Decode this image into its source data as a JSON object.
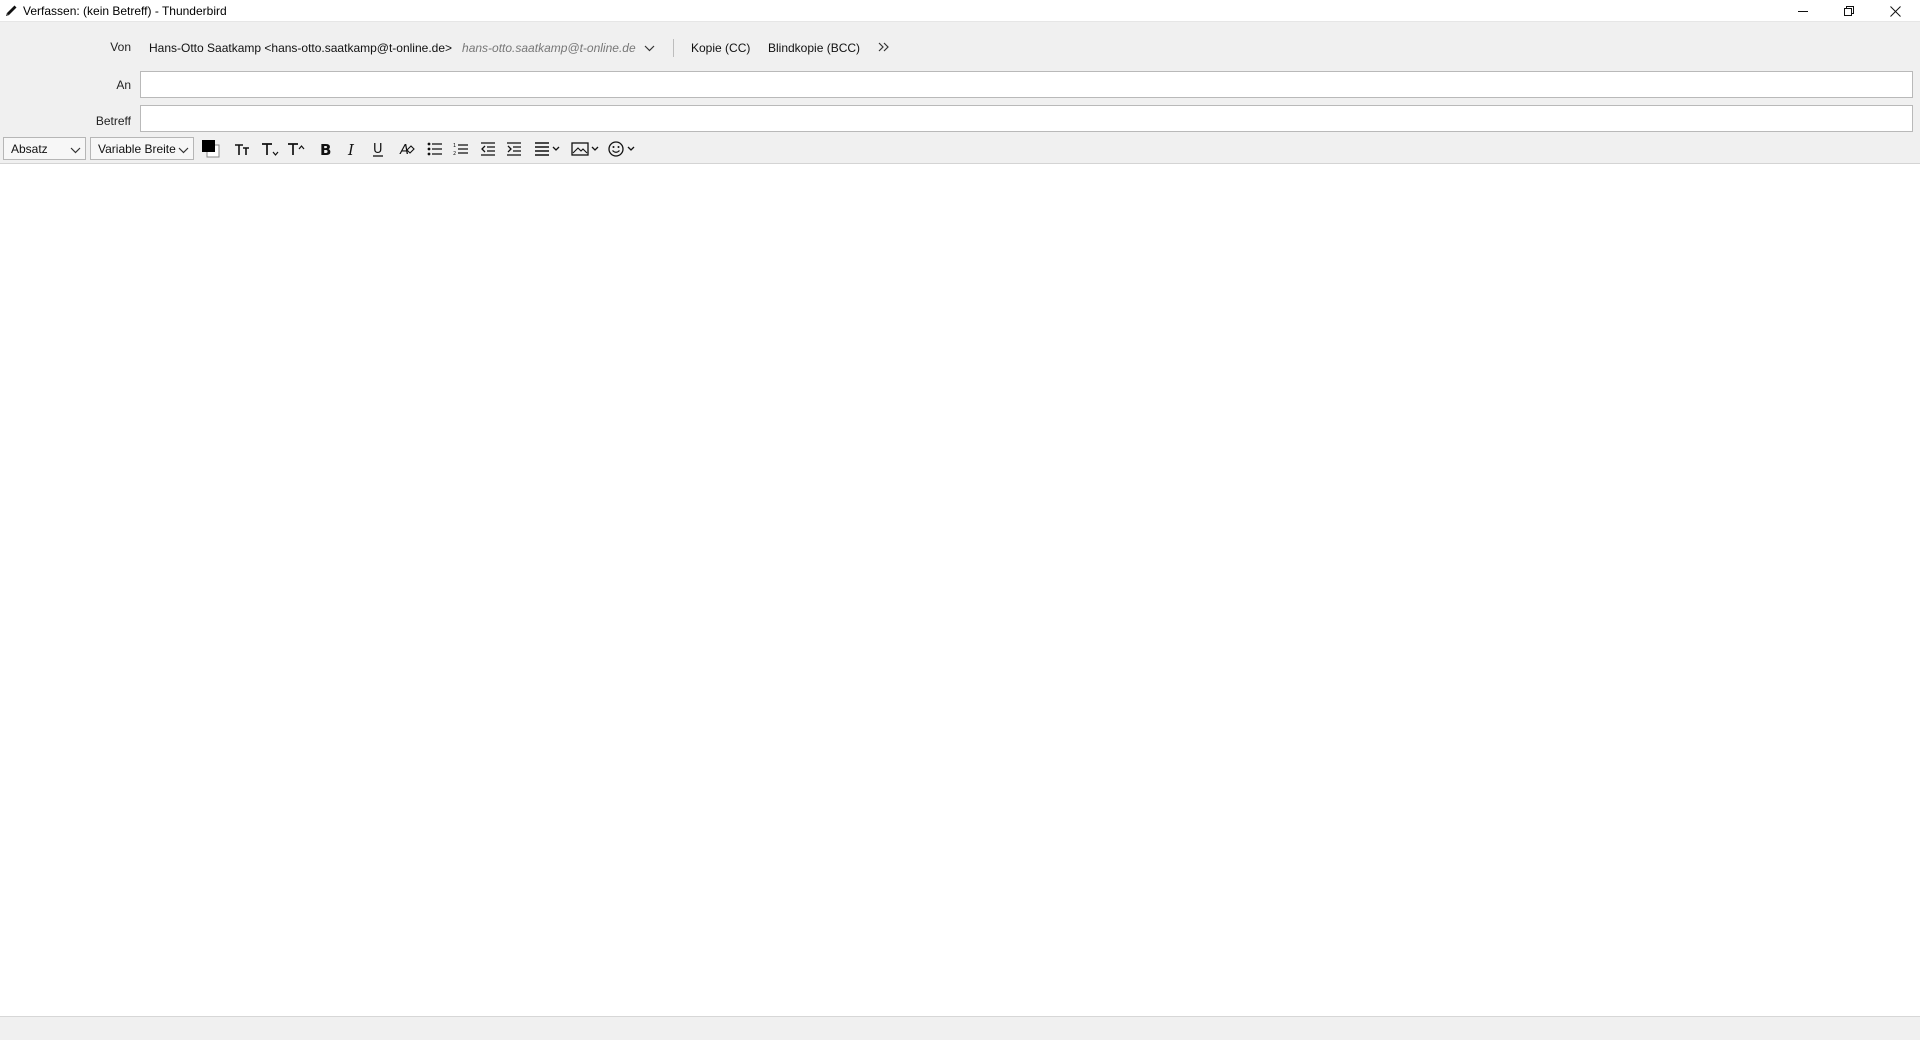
{
  "window": {
    "title": "Verfassen: (kein Betreff) - Thunderbird",
    "icons": {
      "app": "pencil-icon",
      "minimize": "minimize-icon",
      "maximize": "restore-icon",
      "close": "close-icon"
    }
  },
  "header": {
    "from_label": "Von",
    "from_value": "Hans-Otto Saatkamp <hans-otto.saatkamp@t-online.de>",
    "from_hint": "hans-otto.saatkamp@t-online.de",
    "cc_label": "Kopie (CC)",
    "bcc_label": "Blindkopie (BCC)",
    "to_label": "An",
    "to_value": "",
    "subject_label": "Betreff",
    "subject_value": ""
  },
  "format_toolbar": {
    "paragraph_format": "Absatz",
    "font_family": "Variable Breite",
    "text_color": "#000000",
    "background_color": "#ffffff",
    "buttons": [
      "decrease-font-size-icon",
      "subscript-smaller-icon",
      "increase-font-size-icon",
      "bold-icon",
      "italic-icon",
      "underline-icon",
      "remove-formatting-icon",
      "bullet-list-icon",
      "numbered-list-icon",
      "outdent-icon",
      "indent-icon",
      "align-icon",
      "insert-image-icon",
      "emoji-icon"
    ]
  },
  "body": {
    "text": ""
  },
  "colors": {
    "header_bg": "#f0f0f0",
    "border": "#b9b9b9",
    "editor_bg": "#ffffff"
  }
}
